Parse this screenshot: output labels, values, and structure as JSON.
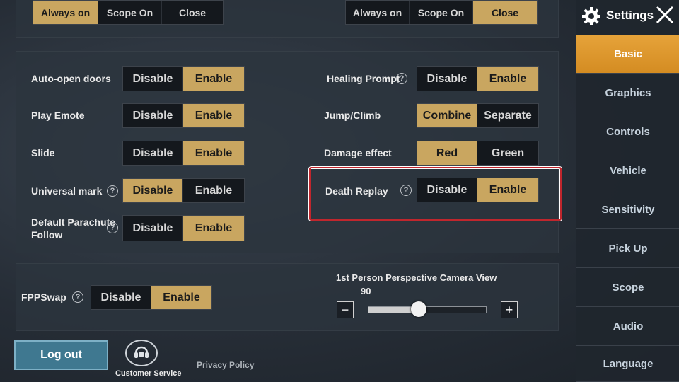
{
  "sidebar": {
    "title": "Settings",
    "items": [
      {
        "label": "Basic"
      },
      {
        "label": "Graphics"
      },
      {
        "label": "Controls"
      },
      {
        "label": "Vehicle"
      },
      {
        "label": "Sensitivity"
      },
      {
        "label": "Pick Up"
      },
      {
        "label": "Scope"
      },
      {
        "label": "Audio"
      },
      {
        "label": "Language"
      }
    ],
    "active_index": 0
  },
  "top_row": {
    "left": [
      "Always on",
      "Scope On",
      "Close"
    ],
    "left_selected": 0,
    "right": [
      "Always on",
      "Scope On",
      "Close"
    ],
    "right_selected": 2
  },
  "left_settings": [
    {
      "label": "Auto-open doors",
      "options": [
        "Disable",
        "Enable"
      ],
      "selected": 1,
      "help": false
    },
    {
      "label": "Play Emote",
      "options": [
        "Disable",
        "Enable"
      ],
      "selected": 1,
      "help": false
    },
    {
      "label": "Slide",
      "options": [
        "Disable",
        "Enable"
      ],
      "selected": 1,
      "help": false
    },
    {
      "label": "Universal mark",
      "options": [
        "Disable",
        "Enable"
      ],
      "selected": 0,
      "help": true
    },
    {
      "label_line1": "Default Parachute",
      "label_line2": "Follow",
      "options": [
        "Disable",
        "Enable"
      ],
      "selected": 1,
      "help": true
    }
  ],
  "right_settings": [
    {
      "label": "Healing Prompt",
      "options": [
        "Disable",
        "Enable"
      ],
      "selected": 1,
      "help": true
    },
    {
      "label": "Jump/Climb",
      "options": [
        "Combine",
        "Separate"
      ],
      "selected": 0,
      "help": false
    },
    {
      "label": "Damage effect",
      "options": [
        "Red",
        "Green"
      ],
      "selected": 0,
      "help": false
    },
    {
      "label": "Death Replay",
      "options": [
        "Disable",
        "Enable"
      ],
      "selected": 1,
      "help": true
    }
  ],
  "fpp": {
    "label": "FPPSwap",
    "options": [
      "Disable",
      "Enable"
    ],
    "selected": 1,
    "camera_label": "1st Person Perspective Camera View",
    "camera_value": "90",
    "slider_fraction": 0.43
  },
  "footer": {
    "logout": "Log out",
    "customer_service": "Customer Service",
    "privacy": "Privacy Policy"
  },
  "colors": {
    "accent": "#c9a660",
    "sidebar_active": "#e09a2d",
    "highlight_border": "#c0262d"
  }
}
